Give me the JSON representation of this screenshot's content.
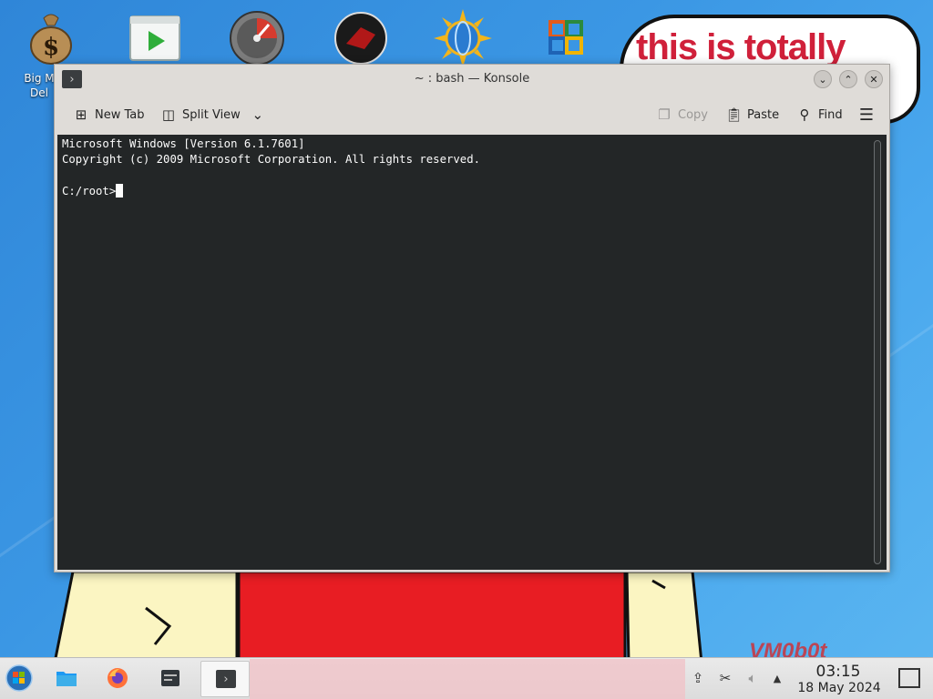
{
  "desktop": {
    "icon_label": "Big M\nDel",
    "bubble_text": "this is totally",
    "watermark": "VM0b0t"
  },
  "window": {
    "title": "~ : bash — Konsole",
    "app_icon": "terminal-icon",
    "controls": [
      "minimize",
      "maximize",
      "close"
    ]
  },
  "toolbar": {
    "new_tab": "New Tab",
    "split_view": "Split View",
    "copy": "Copy",
    "paste": "Paste",
    "find": "Find"
  },
  "terminal": {
    "lines": [
      "Microsoft Windows [Version 6.1.7601]",
      "Copyright (c) 2009 Microsoft Corporation. All rights reserved.",
      "",
      "C:/root>"
    ]
  },
  "taskbar": {
    "clock_time": "03:15",
    "clock_date": "18 May 2024",
    "tray_icons": [
      "updates-icon",
      "clipboard-scissors-icon",
      "volume-icon",
      "expand-tray-icon"
    ]
  },
  "colors": {
    "terminal_bg": "#232627",
    "terminal_fg": "#fcfcfc",
    "window_chrome": "#dfdcd8",
    "bubble_text": "#d0203a"
  }
}
